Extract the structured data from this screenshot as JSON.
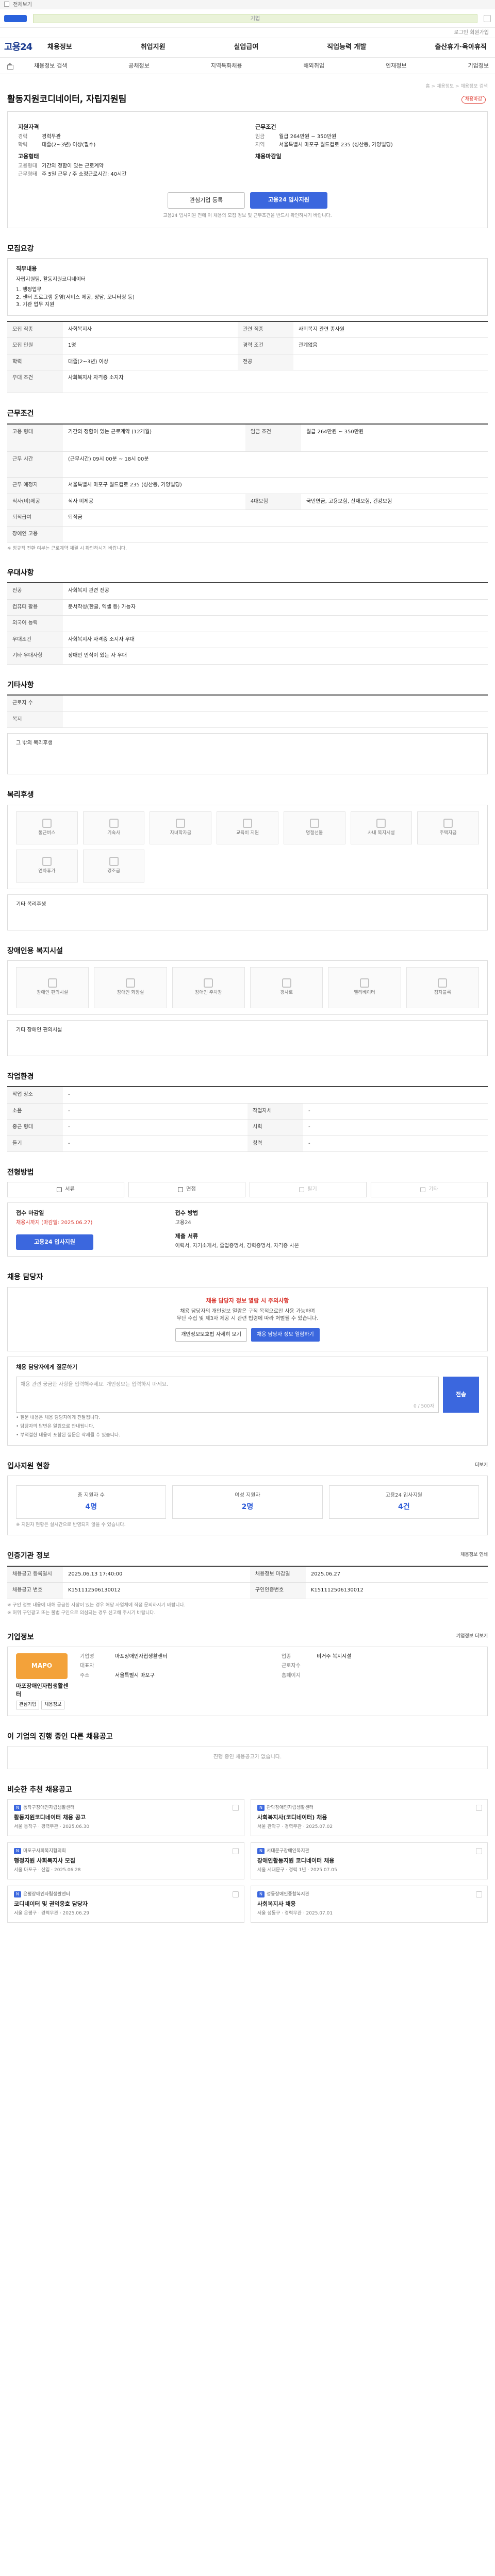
{
  "banner": {
    "text": "전체보기"
  },
  "search": {
    "placeholder": "기업"
  },
  "util": {
    "links": "로그인 회원가입"
  },
  "gnb": {
    "brand": "고용24",
    "items": [
      "채용정보",
      "취업지원",
      "실업급여",
      "직업능력 개발",
      "출산휴가·육아휴직"
    ]
  },
  "lnb": {
    "items": [
      "채용정보 검색",
      "공채정보",
      "지역특화채용",
      "해외취업",
      "인재정보",
      "기업정보"
    ]
  },
  "header": {
    "crumb": "홈 > 채용정보 > 채용정보 검색",
    "title": "활동지원코디네이터, 자립지원팀",
    "tag": "채용마감"
  },
  "summary": {
    "left_title": "지원자격",
    "left": [
      {
        "k": "경력",
        "v": "경력무관"
      },
      {
        "k": "학력",
        "v": "대졸(2~3년) 이상(필수)"
      }
    ],
    "left_title2": "고용형태",
    "left2": [
      {
        "k": "고용형태",
        "v": "기간의 정함이 있는 근로계약"
      },
      {
        "k": "근무형태",
        "v": "주 5일 근무 / 주 소정근로시간: 40시간"
      }
    ],
    "right_title": "근무조건",
    "right": [
      {
        "k": "임금",
        "v": "월급 264만원 ~ 350만원"
      },
      {
        "k": "지역",
        "v": "서울특별시 마포구 월드컵로 235 (성산동, 가양빌딩)"
      }
    ],
    "right_title2": "채용마감일",
    "btn_save": "관심기업 등록",
    "btn_apply": "고용24 입사지원",
    "notice": "고용24 입사지원 전에 이 채용의 모집 정보 및 근무조건을 반드시 확인하시기 바랍니다."
  },
  "recruit": {
    "title": "모집요강",
    "duties_label": "직무내용",
    "duties": [
      "자립지원팀, 활동지원코디네이터",
      "1. 행정업무",
      "2. 센터 프로그램 운영(서비스 제공, 상담, 모니터링 등)",
      "3. 기관 업무 지원"
    ],
    "rows": [
      {
        "k": "모집 직종",
        "v": "사회복지사",
        "k2": "관련 직종",
        "v2": "사회복지 관련 종사원"
      },
      {
        "k": "모집 인원",
        "v": "1명",
        "k2": "경력 조건",
        "v2": "관계없음"
      },
      {
        "k": "학력",
        "v": "대졸(2~3년) 이상",
        "k2": "전공",
        "v2": ""
      },
      {
        "k": "우대 조건",
        "v": "사회복지사 자격증 소지자",
        "k2": "",
        "v2": ""
      }
    ]
  },
  "conditions": {
    "title": "근무조건",
    "rows": [
      {
        "k": "고용 형태",
        "v": "기간의 정함이 있는 근로계약 (12개월)",
        "k2": "임금 조건",
        "v2": "월급 264만원 ~ 350만원"
      },
      {
        "k": "근무 시간",
        "v": "(근무시간) 09시 00분 ~ 18시 00분",
        "k2": "",
        "v2": ""
      },
      {
        "k": "근무 예정지",
        "v": "서울특별시 마포구 월드컵로 235 (성산동, 가양빌딩)",
        "k2": "",
        "v2": ""
      },
      {
        "k": "식사(비)제공",
        "v": "식사 미제공",
        "k2": "4대보험",
        "v2": "국민연금, 고용보험, 산재보험, 건강보험"
      },
      {
        "k": "퇴직급여",
        "v": "퇴직금",
        "k2": "",
        "v2": ""
      },
      {
        "k": "장애인 고용",
        "v": "",
        "k2": "",
        "v2": ""
      }
    ],
    "note": "※ 정규직 전환 여부는 근로계약 체결 시 확인하시기 바랍니다."
  },
  "benefit": {
    "title": "우대사항",
    "rows": [
      {
        "k": "전공",
        "v": "사회복지 관련 전공"
      },
      {
        "k": "컴퓨터 활용",
        "v": "문서작성(한글, 엑셀 등) 가능자"
      },
      {
        "k": "외국어 능력",
        "v": ""
      },
      {
        "k": "우대조건",
        "v": "사회복지사 자격증 소지자 우대"
      },
      {
        "k": "기타 우대사항",
        "v": "장애인 인식이 있는 자 우대"
      }
    ]
  },
  "other": {
    "title": "기타사항",
    "rows": [
      {
        "k": "근로자 수",
        "v": ""
      },
      {
        "k": "복지",
        "v": ""
      }
    ],
    "extra_label": "그 밖의 복리후생"
  },
  "welfare": {
    "title": "복리후생",
    "items": [
      "통근버스",
      "기숙사",
      "자녀학자금",
      "교육비 지원",
      "명절선물",
      "사내 복지시설",
      "주택자금"
    ],
    "items2": [
      "연차휴가",
      "경조금"
    ],
    "extra": "기타 복리후생"
  },
  "disability": {
    "title": "장애인용 복지시설",
    "items": [
      "장애인 편의시설",
      "장애인 화장실",
      "장애인 주차장",
      "경사로",
      "엘리베이터",
      "점자블록"
    ],
    "extra": "기타 장애인 편의시설"
  },
  "env": {
    "title": "작업환경",
    "rows": [
      {
        "k": "작업 장소",
        "v": "-",
        "k2": "",
        "v2": ""
      },
      {
        "k": "소음",
        "v": "-",
        "k2": "작업자세",
        "v2": "-"
      },
      {
        "k": "중근 형태",
        "v": "-",
        "k2": "시력",
        "v2": "-"
      },
      {
        "k": "들기",
        "v": "-",
        "k2": "청력",
        "v2": "-"
      }
    ]
  },
  "apply": {
    "title": "전형방법",
    "methods": [
      "서류",
      "면접",
      "필기",
      "기타"
    ],
    "method_active": [
      true,
      true,
      false,
      false
    ],
    "deadline_k": "접수 마감일",
    "deadline_v": "채용시까지 (마감일: 2025.06.27)",
    "how_k": "접수 방법",
    "how_v": "고용24",
    "docs_k": "제출 서류",
    "docs_v": "이력서, 자기소개서, 졸업증명서, 경력증명서, 자격증 사본",
    "btn": "고용24 입사지원"
  },
  "contact": {
    "title": "채용 담당자",
    "warn": "채용 담당자 정보 열람 시 주의사항",
    "desc1": "채용 담당자의 개인정보 열람은 구직 목적으로만 사용 가능하며",
    "desc2": "무단 수집 및 제3자 제공 시 관련 법령에 따라 처벌될 수 있습니다.",
    "btn1": "개인정보보호법 자세히 보기",
    "btn2": "채용 담당자 정보 열람하기",
    "q_label": "채용 담당자에게 질문하기",
    "q_placeholder": "채용 관련 궁금한 사항을 입력해주세요. 개인정보는 입력하지 마세요.",
    "q_count": "0 / 500자",
    "send": "전송",
    "bullets": [
      "• 질문 내용은 채용 담당자에게 전달됩니다.",
      "• 담당자의 답변은 알림으로 안내됩니다.",
      "• 부적절한 내용이 포함된 질문은 삭제될 수 있습니다."
    ]
  },
  "stats": {
    "title": "입사지원 현황",
    "more": "더보기",
    "items": [
      {
        "label": "총 지원자 수",
        "value": "4명"
      },
      {
        "label": "여성 지원자",
        "value": "2명"
      },
      {
        "label": "고용24 입사지원",
        "value": "4건"
      }
    ],
    "note": "※ 지원자 현황은 실시간으로 반영되지 않을 수 있습니다."
  },
  "regist": {
    "title": "인증기관 정보",
    "rows": [
      {
        "k": "채용공고 등록일시",
        "v": "2025.06.13 17:40:00",
        "k2": "채용정보 마감일",
        "v2": "2025.06.27"
      },
      {
        "k": "채용공고 번호",
        "v": "K151112506130012",
        "k2": "구인인증번호",
        "v2": "K151112506130012"
      }
    ],
    "notes": [
      "※ 구인 정보 내용에 대해 궁금한 사항이 있는 경우 해당 사업체에 직접 문의하시기 바랍니다.",
      "※ 허위 구인광고 또는 불법 구인으로 의심되는 경우 신고해 주시기 바랍니다."
    ],
    "print": "채용정보 인쇄"
  },
  "company": {
    "title": "기업정보",
    "more": "기업정보 더보기",
    "logo_text": "MAPO",
    "name": "마포장애인자립생활센터",
    "btn1": "관심기업",
    "btn2": "채용정보",
    "info": [
      {
        "k": "기업명",
        "v": "마포장애인자립생활센터"
      },
      {
        "k": "업종",
        "v": "비거주 복지시설"
      },
      {
        "k": "대표자",
        "v": ""
      },
      {
        "k": "근로자수",
        "v": ""
      },
      {
        "k": "주소",
        "v": "서울특별시 마포구"
      },
      {
        "k": "홈페이지",
        "v": ""
      }
    ]
  },
  "others": {
    "title": "이 기업의 진행 중인 다른 채용공고",
    "empty": "진행 중인 채용공고가 없습니다."
  },
  "recs": {
    "title": "비슷한 추천 채용공고",
    "items": [
      {
        "org": "동작구장애인자립생활센터",
        "title": "활동지원코디네이터 채용 공고",
        "meta": "서울 동작구 · 경력무관 · 2025.06.30"
      },
      {
        "org": "관악장애인자립생활센터",
        "title": "사회복지사(코디네이터) 채용",
        "meta": "서울 관악구 · 경력무관 · 2025.07.02"
      },
      {
        "org": "마포구사회복지협의회",
        "title": "행정지원 사회복지사 모집",
        "meta": "서울 마포구 · 신입 · 2025.06.28"
      },
      {
        "org": "서대문구장애인복지관",
        "title": "장애인활동지원 코디네이터 채용",
        "meta": "서울 서대문구 · 경력 1년 · 2025.07.05"
      },
      {
        "org": "은평장애인자립생활센터",
        "title": "코디네이터 및 권익옹호 담당자",
        "meta": "서울 은평구 · 경력무관 · 2025.06.29"
      },
      {
        "org": "성동장애인종합복지관",
        "title": "사회복지사 채용",
        "meta": "서울 성동구 · 경력무관 · 2025.07.01"
      }
    ]
  }
}
